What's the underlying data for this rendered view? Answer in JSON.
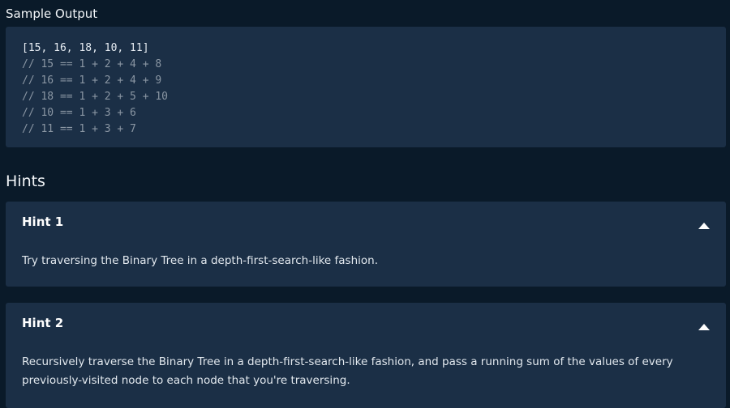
{
  "sample_output": {
    "label": "Sample Output",
    "lines": [
      {
        "text": "[15, 16, 18, 10, 11]",
        "kind": "main"
      },
      {
        "text": "// 15 == 1 + 2 + 4 + 8",
        "kind": "comment"
      },
      {
        "text": "// 16 == 1 + 2 + 4 + 9",
        "kind": "comment"
      },
      {
        "text": "// 18 == 1 + 2 + 5 + 10",
        "kind": "comment"
      },
      {
        "text": "// 10 == 1 + 3 + 6",
        "kind": "comment"
      },
      {
        "text": "// 11 == 1 + 3 + 7",
        "kind": "comment"
      }
    ]
  },
  "hints": {
    "title": "Hints",
    "items": [
      {
        "title": "Hint 1",
        "body": "Try traversing the Binary Tree in a depth-first-search-like fashion.",
        "expanded": true
      },
      {
        "title": "Hint 2",
        "body": "Recursively traverse the Binary Tree in a depth-first-search-like fashion, and pass a running sum of the values of every previously-visited node to each node that you're traversing.",
        "expanded": true
      }
    ]
  },
  "colors": {
    "page_background": "#0a1a29",
    "card_background": "#1b2f46",
    "comment_text": "#8a96a3"
  },
  "icons": {
    "hint_toggle": "chevron-up-icon"
  }
}
